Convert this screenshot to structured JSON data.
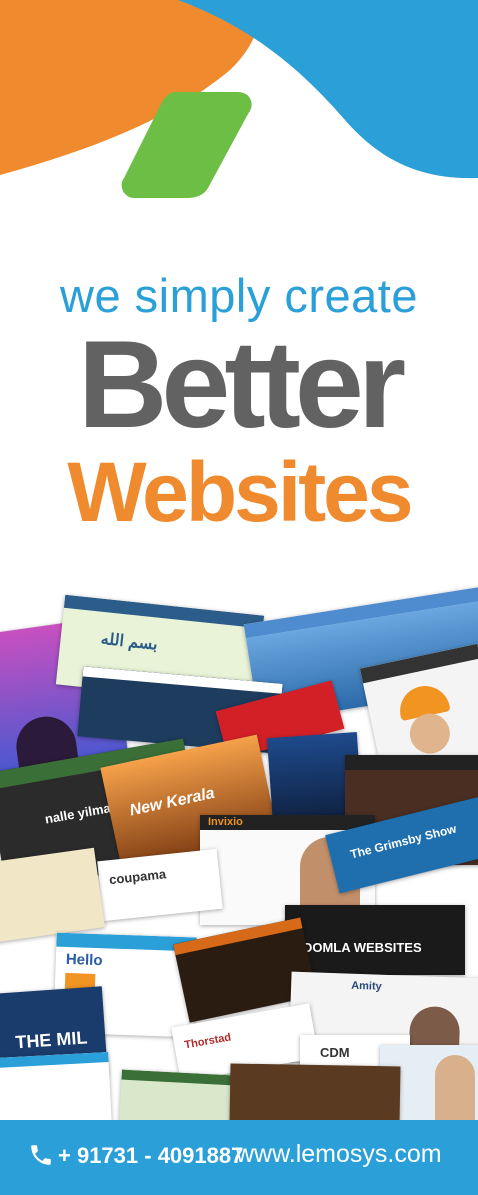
{
  "colors": {
    "orange": "#f08a2e",
    "blue": "#2a9fd8",
    "green": "#6cbe45",
    "gray": "#626262"
  },
  "headline": {
    "tagline": "we simply create",
    "line1": "Better",
    "line2": "Websites"
  },
  "collage": {
    "description_icon": "website-screenshots",
    "screens": [
      {
        "label": "Invixio"
      },
      {
        "label": "coupama"
      },
      {
        "label": "Hello"
      },
      {
        "label": "nalle yilmaz"
      },
      {
        "label": "The Grimsby Show"
      },
      {
        "label": "JOOMLA WEBSITES"
      },
      {
        "label": "Amity"
      },
      {
        "label": "CDM"
      },
      {
        "label": "THE MIL"
      },
      {
        "label": "Thorstad"
      }
    ]
  },
  "footer": {
    "phone_icon": "phone-icon",
    "phone": "+ 91731 - 4091887",
    "website": "www.lemosys.com"
  }
}
